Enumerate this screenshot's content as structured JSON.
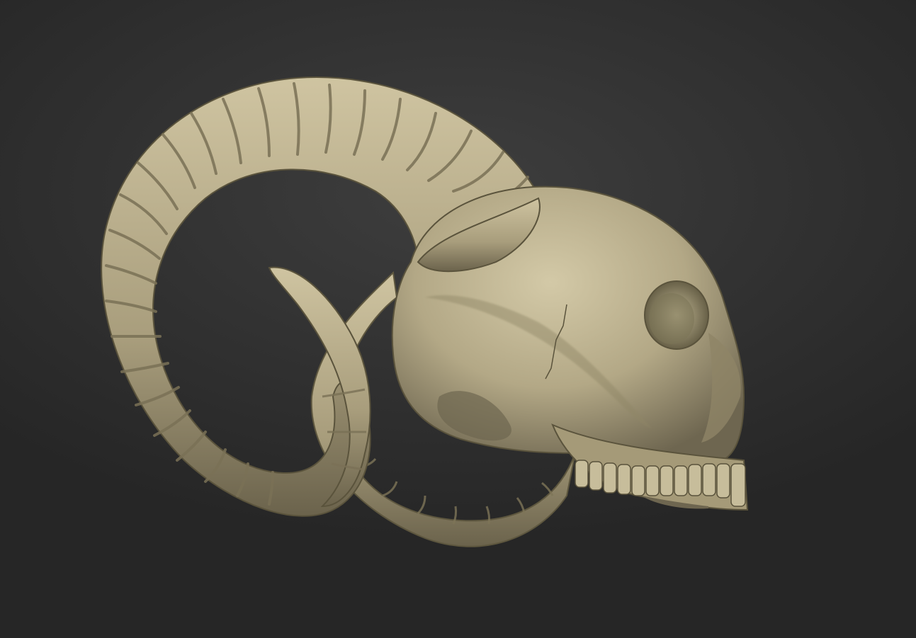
{
  "viewport": {
    "background_top": "#3c3c3c",
    "background_bottom": "#262626"
  },
  "model": {
    "subject": "ram-skull-sculpt",
    "material_color": "#b3a886",
    "material_shadow": "#6e6650",
    "material_highlight": "#d6ccab"
  }
}
